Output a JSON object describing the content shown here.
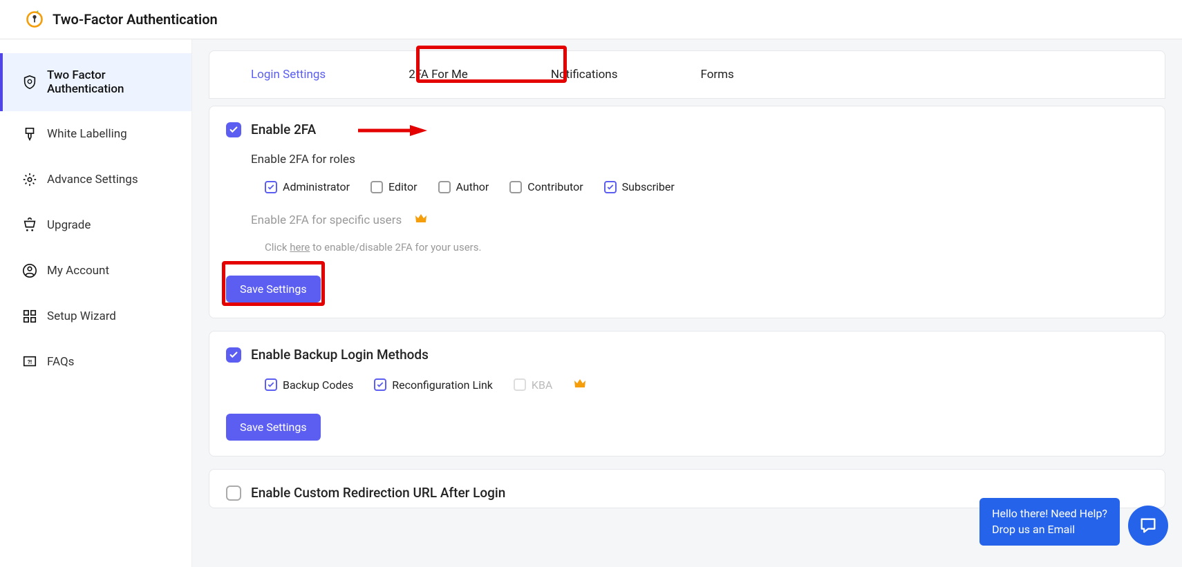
{
  "header": {
    "title": "Two-Factor Authentication"
  },
  "sidebar": {
    "items": [
      {
        "label": "Two Factor Authentication"
      },
      {
        "label": "White Labelling"
      },
      {
        "label": "Advance Settings"
      },
      {
        "label": "Upgrade"
      },
      {
        "label": "My Account"
      },
      {
        "label": "Setup Wizard"
      },
      {
        "label": "FAQs"
      }
    ]
  },
  "tabs": {
    "items": [
      {
        "label": "Login Settings"
      },
      {
        "label": "2FA For Me"
      },
      {
        "label": "Notifications"
      },
      {
        "label": "Forms"
      }
    ]
  },
  "section1": {
    "title": "Enable 2FA",
    "roles_title": "Enable 2FA for roles",
    "roles": [
      {
        "label": "Administrator",
        "checked": true
      },
      {
        "label": "Editor",
        "checked": false
      },
      {
        "label": "Author",
        "checked": false
      },
      {
        "label": "Contributor",
        "checked": false
      },
      {
        "label": "Subscriber",
        "checked": true
      }
    ],
    "specific_users": "Enable 2FA for specific users",
    "instruction_click": "Click",
    "instruction_here": "here",
    "instruction_rest": "to enable/disable 2FA for your users.",
    "save": "Save Settings"
  },
  "section2": {
    "title": "Enable Backup Login Methods",
    "methods": [
      {
        "label": "Backup Codes",
        "checked": true,
        "disabled": false
      },
      {
        "label": "Reconfiguration Link",
        "checked": true,
        "disabled": false
      },
      {
        "label": "KBA",
        "checked": false,
        "disabled": true
      }
    ],
    "save": "Save Settings"
  },
  "section3": {
    "title": "Enable Custom Redirection URL After Login"
  },
  "help": {
    "line1": "Hello there! Need Help?",
    "line2": "Drop us an Email"
  }
}
